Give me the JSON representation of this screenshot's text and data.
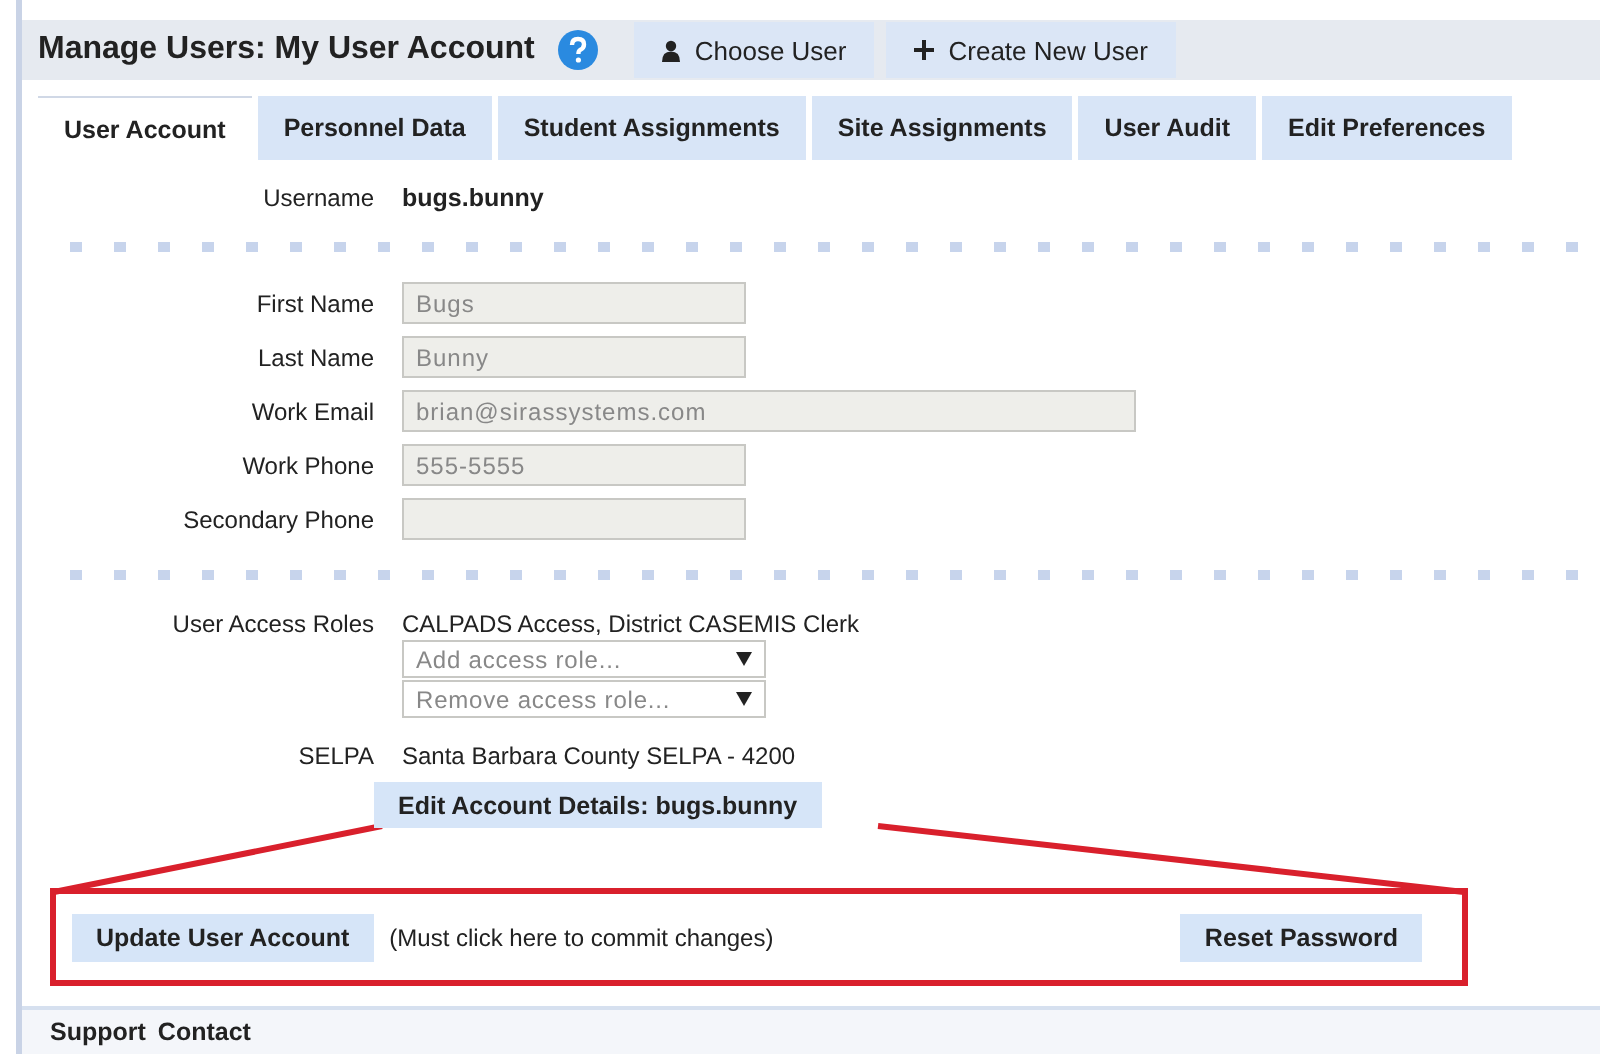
{
  "header": {
    "title": "Manage Users: My User Account",
    "buttons": [
      {
        "label": "Choose User",
        "kind": "person"
      },
      {
        "label": "Create New User",
        "kind": "plus"
      }
    ]
  },
  "tabs": [
    {
      "label": "User Account",
      "selected": true
    },
    {
      "label": "Personnel Data",
      "selected": false
    },
    {
      "label": "Student Assignments",
      "selected": false
    },
    {
      "label": "Site Assignments",
      "selected": false
    },
    {
      "label": "User Audit",
      "selected": false
    },
    {
      "label": "Edit Preferences",
      "selected": false
    }
  ],
  "username": {
    "label": "Username",
    "value": "bugs.bunny"
  },
  "fields": [
    {
      "label": "First Name",
      "value": "Bugs",
      "disabled": true,
      "kind": "text"
    },
    {
      "label": "Last Name",
      "value": "Bunny",
      "disabled": true,
      "kind": "text"
    },
    {
      "label": "Work Email",
      "value": "brian@sirassystems.com",
      "disabled": true,
      "kind": "email"
    },
    {
      "label": "Work Phone",
      "value": "555-5555",
      "disabled": true,
      "kind": "text"
    },
    {
      "label": "Secondary Phone",
      "disabled": true,
      "kind": "text"
    }
  ],
  "roles": {
    "label": "User Access Roles",
    "value": "CALPADS Access, District CASEMIS Clerk",
    "dropdowns": [
      {
        "placeholder": "Add access role..."
      },
      {
        "placeholder": "Remove access role..."
      }
    ]
  },
  "selpa": {
    "label": "SELPA",
    "value": "Santa Barbara County SELPA - 4200"
  },
  "edit_button": "Edit Account Details: bugs.bunny",
  "callout": {
    "update_button": "Update User Account",
    "note": "(Must click here to commit changes)",
    "reset_button": "Reset Password"
  },
  "footer": {
    "links": [
      "Support",
      "Contact"
    ]
  }
}
